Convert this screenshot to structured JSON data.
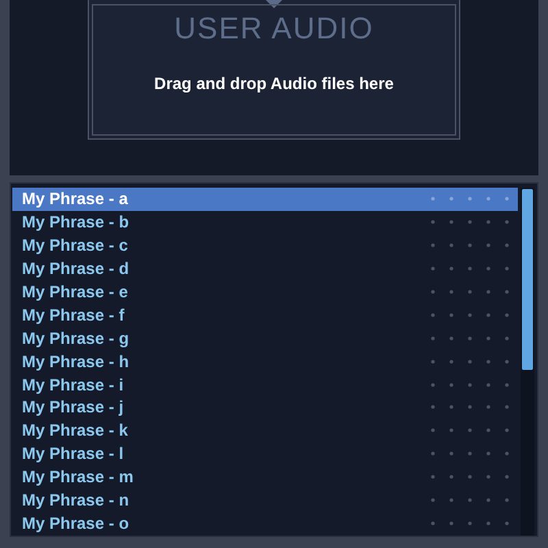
{
  "dropzone": {
    "title": "USER AUDIO",
    "hint": "Drag and drop Audio files here"
  },
  "phrases": [
    {
      "label": "My Phrase - a",
      "selected": true
    },
    {
      "label": "My Phrase - b",
      "selected": false
    },
    {
      "label": "My Phrase - c",
      "selected": false
    },
    {
      "label": "My Phrase - d",
      "selected": false
    },
    {
      "label": "My Phrase - e",
      "selected": false
    },
    {
      "label": "My Phrase - f",
      "selected": false
    },
    {
      "label": "My Phrase - g",
      "selected": false
    },
    {
      "label": "My Phrase - h",
      "selected": false
    },
    {
      "label": "My Phrase - i",
      "selected": false
    },
    {
      "label": "My Phrase - j",
      "selected": false
    },
    {
      "label": "My Phrase - k",
      "selected": false
    },
    {
      "label": "My Phrase - l",
      "selected": false
    },
    {
      "label": "My Phrase - m",
      "selected": false
    },
    {
      "label": "My Phrase - n",
      "selected": false
    },
    {
      "label": "My Phrase - o",
      "selected": false
    }
  ]
}
